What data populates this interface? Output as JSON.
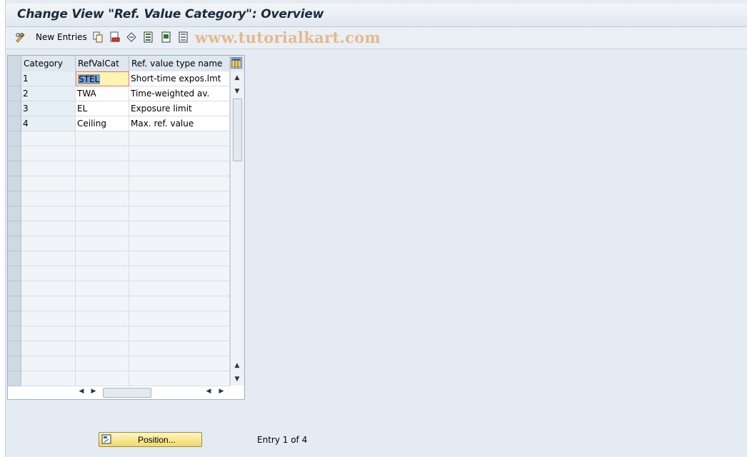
{
  "title": "Change View \"Ref. Value Category\": Overview",
  "toolbar": {
    "new_entries_label": "New Entries",
    "icons": [
      "pencil-glasses-icon",
      "copy-icon",
      "delete-icon",
      "undo-icon",
      "select-all-icon",
      "select-block-icon",
      "deselect-icon"
    ],
    "watermark": "www.tutorialkart.com"
  },
  "table": {
    "columns": [
      "Category",
      "RefValCat",
      "Ref. value type name"
    ],
    "rows": [
      {
        "category": "1",
        "refvalcat": "STEL",
        "name": "Short-time expos.lmt"
      },
      {
        "category": "2",
        "refvalcat": "TWA",
        "name": "Time-weighted av."
      },
      {
        "category": "3",
        "refvalcat": "EL",
        "name": "Exposure limit"
      },
      {
        "category": "4",
        "refvalcat": "Ceiling",
        "name": "Max. ref. value"
      }
    ]
  },
  "footer": {
    "position_button": "Position...",
    "entry_info": "Entry 1 of 4"
  },
  "colors": {
    "background": "#e4ebf2",
    "button_yellow": "#f3d86a",
    "selection_blue": "#7aa0cf"
  }
}
